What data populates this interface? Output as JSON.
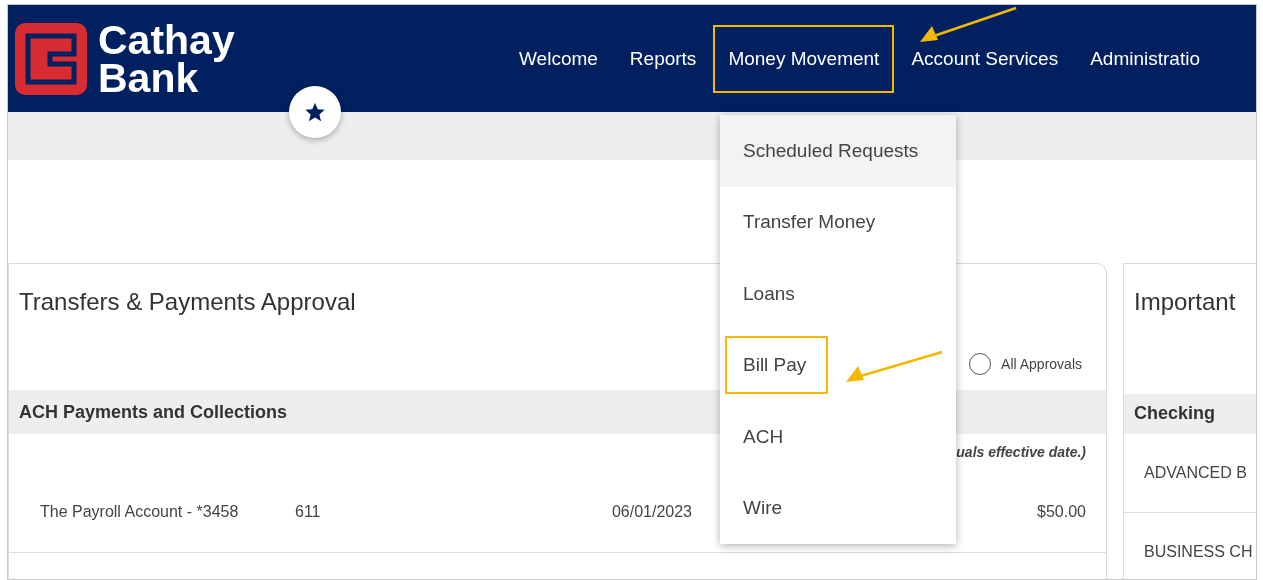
{
  "logo": {
    "line_1": "Cathay",
    "line_2": "Bank"
  },
  "nav": [
    {
      "label": "Welcome",
      "annotated": false
    },
    {
      "label": "Reports",
      "annotated": false
    },
    {
      "label": "Money Movement",
      "annotated": true
    },
    {
      "label": "Account Services",
      "annotated": false
    },
    {
      "label": "Administratio",
      "annotated": false
    }
  ],
  "menu": [
    {
      "label": "Scheduled Requests",
      "selected": true,
      "annotated": false
    },
    {
      "label": "Transfer Money",
      "selected": false,
      "annotated": false
    },
    {
      "label": "Loans",
      "selected": false,
      "annotated": false
    },
    {
      "label": "Bill Pay",
      "selected": false,
      "annotated": true
    },
    {
      "label": "ACH",
      "selected": false,
      "annotated": false
    },
    {
      "label": "Wire",
      "selected": false,
      "annotated": false
    }
  ],
  "approval_card": {
    "title": "Transfers & Payments Approval",
    "radio": {
      "label": "All Approvals",
      "selected": false
    },
    "section": "ACH Payments and Collections",
    "note": "uals effective date.)",
    "row": [
      "The Payroll Account - *3458",
      "611",
      "06/01/2023",
      "$50.00"
    ]
  },
  "important_card": {
    "title": "Important",
    "section": "Checking",
    "rows": [
      "ADVANCED B",
      "BUSINESS CH"
    ]
  }
}
